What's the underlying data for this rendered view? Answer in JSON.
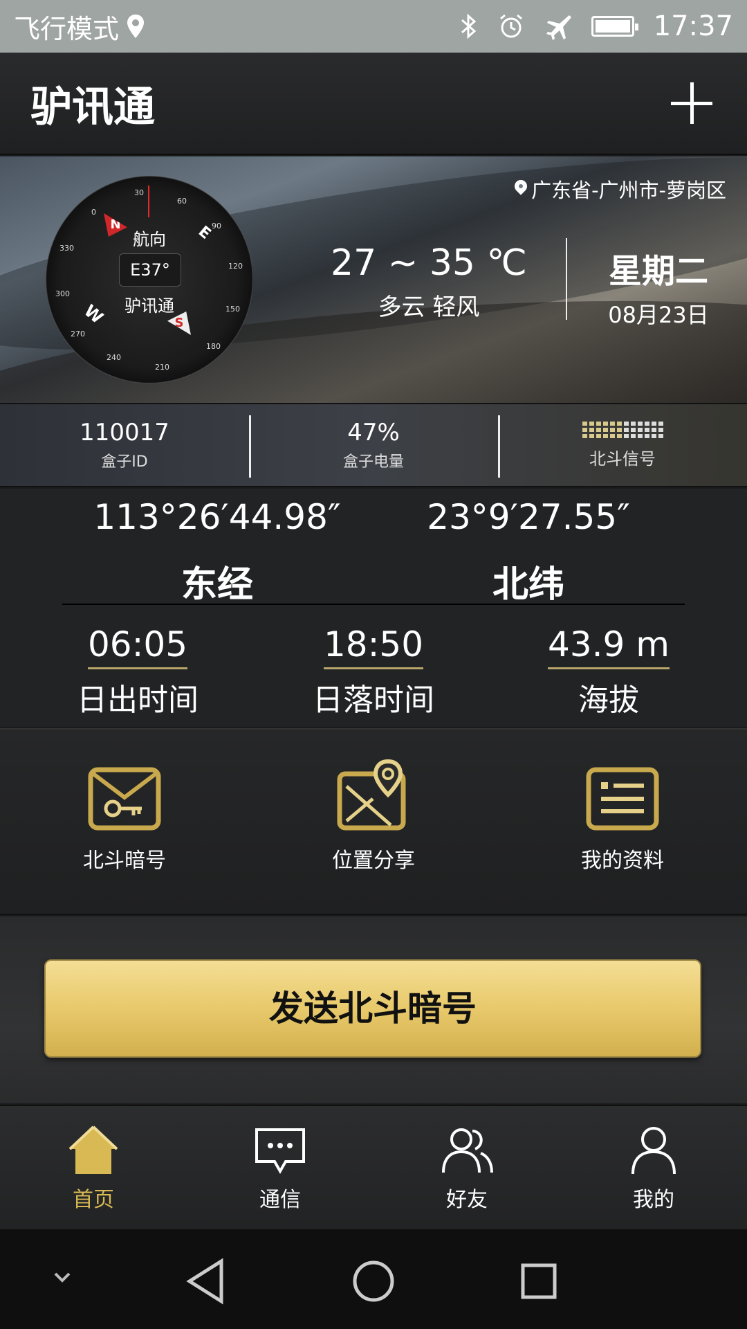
{
  "status_bar": {
    "mode_text": "飞行模式",
    "time": "17:37",
    "battery_level": 1.0,
    "icons": [
      "location-icon",
      "bluetooth-icon",
      "alarm-icon",
      "airplane-icon",
      "battery-icon"
    ]
  },
  "app_bar": {
    "title": "驴讯通",
    "add_icon": "plus-icon"
  },
  "weather": {
    "location": "广东省-广州市-萝岗区",
    "temperature_range": "27 ~ 35 ℃",
    "condition": "多云  轻风",
    "weekday": "星期二",
    "date": "08月23日"
  },
  "compass": {
    "heading_label": "航向",
    "heading_value": "E37°",
    "brand": "驴讯通",
    "north": "N",
    "south": "S",
    "east": "E",
    "west": "W",
    "ticks": [
      "30",
      "60",
      "90",
      "120",
      "150",
      "180",
      "210",
      "240",
      "270",
      "300",
      "330",
      "0"
    ]
  },
  "box_info": {
    "id_value": "110017",
    "id_label": "盒子ID",
    "battery_value": "47%",
    "battery_label": "盒子电量",
    "signal_label": "北斗信号"
  },
  "coordinates": {
    "longitude_value": "113°26′44.98″",
    "longitude_label": "东经",
    "latitude_value": "23°9′27.55″",
    "latitude_label": "北纬"
  },
  "sun": {
    "sunrise_value": "06:05",
    "sunrise_label": "日出时间",
    "sunset_value": "18:50",
    "sunset_label": "日落时间",
    "altitude_value": "43.9 m",
    "altitude_label": "海拔"
  },
  "features": [
    {
      "label": "北斗暗号",
      "icon": "envelope-key-icon"
    },
    {
      "label": "位置分享",
      "icon": "map-pin-icon"
    },
    {
      "label": "我的资料",
      "icon": "profile-card-icon"
    }
  ],
  "cta": {
    "label": "发送北斗暗号"
  },
  "bottom_nav": [
    {
      "label": "首页",
      "icon": "home-icon",
      "active": true
    },
    {
      "label": "通信",
      "icon": "chat-icon",
      "active": false
    },
    {
      "label": "好友",
      "icon": "friends-icon",
      "active": false
    },
    {
      "label": "我的",
      "icon": "user-icon",
      "active": false
    }
  ],
  "colors": {
    "accent_gold": "#d8b954",
    "cta_gold": "#e8c96b",
    "status_bar": "#9fa5a2",
    "background": "#222324"
  }
}
